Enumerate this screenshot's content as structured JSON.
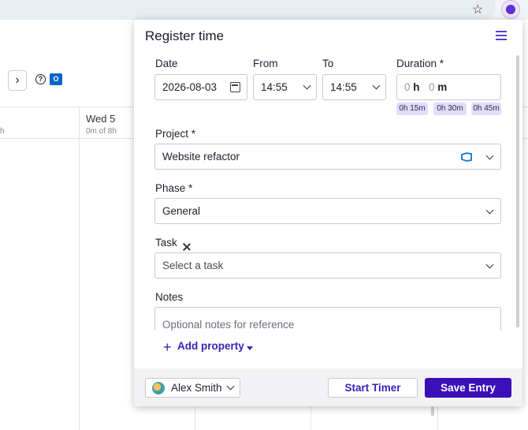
{
  "browser": {
    "star_icon": "star-icon",
    "extension_icon": "extension-icon"
  },
  "calendar_bg": {
    "day_name": "Wed 5",
    "day_sub": "0m of 8h",
    "left_sub": "h"
  },
  "panel": {
    "title": "Register time",
    "date": {
      "label": "Date",
      "value": "2026-08-03"
    },
    "from": {
      "label": "From",
      "value": "14:55"
    },
    "to": {
      "label": "To",
      "value": "14:55"
    },
    "duration": {
      "label": "Duration *",
      "hours_value": "0",
      "hours_unit": "h",
      "minutes_value": "0",
      "minutes_unit": "m",
      "chips": [
        "0h 15m",
        "0h 30m",
        "0h 45m"
      ]
    },
    "project": {
      "label": "Project *",
      "value": "Website refactor"
    },
    "phase": {
      "label": "Phase *",
      "value": "General"
    },
    "task": {
      "label": "Task",
      "placeholder": "Select a task"
    },
    "notes": {
      "label": "Notes",
      "placeholder": "Optional notes for reference"
    },
    "add_property": "Add property",
    "footer": {
      "user": "Alex Smith",
      "start_timer": "Start Timer",
      "save_entry": "Save Entry"
    }
  },
  "colors": {
    "accent": "#3a0fb8",
    "chip_bg": "#e3dbfb",
    "footer_bg": "#f2f2f4"
  }
}
